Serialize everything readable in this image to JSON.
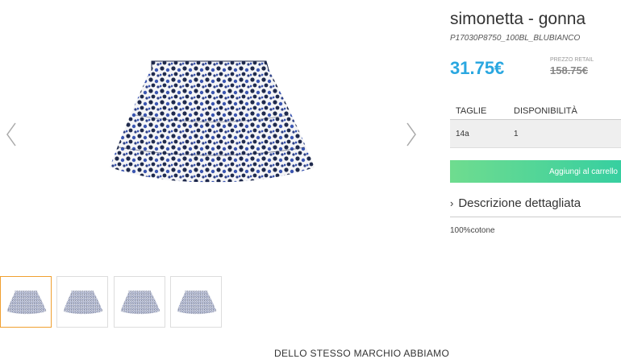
{
  "product": {
    "title": "simonetta - gonna",
    "sku": "P17030P8750_100BL_BLUBIANCO",
    "price": "31.75€",
    "retail_label": "PREZZO RETAIL",
    "retail_price": "158.75€"
  },
  "sizes": {
    "header_size": "TAGLIE",
    "header_availability": "DISPONIBILITÀ",
    "rows": [
      {
        "size": "14a",
        "availability": "1"
      }
    ]
  },
  "cart": {
    "add_label": "Aggiungi al carrello"
  },
  "description": {
    "toggle_label": "Descrizione dettagliata",
    "text": "100%cotone"
  },
  "gallery": {
    "prev_icon": "chevron-left-icon",
    "next_icon": "chevron-right-icon",
    "thumb_count": 4,
    "active_thumb": 0
  },
  "footer": {
    "heading": "DELLO STESSO MARCHIO ABBIAMO"
  },
  "colors": {
    "price": "#2aa7e0",
    "button_start": "#6fdc8f",
    "button_end": "#37cfa0",
    "active_thumb_border": "#f0a030",
    "skirt_dark": "#1f2a4d",
    "skirt_blue": "#3a55b0"
  }
}
